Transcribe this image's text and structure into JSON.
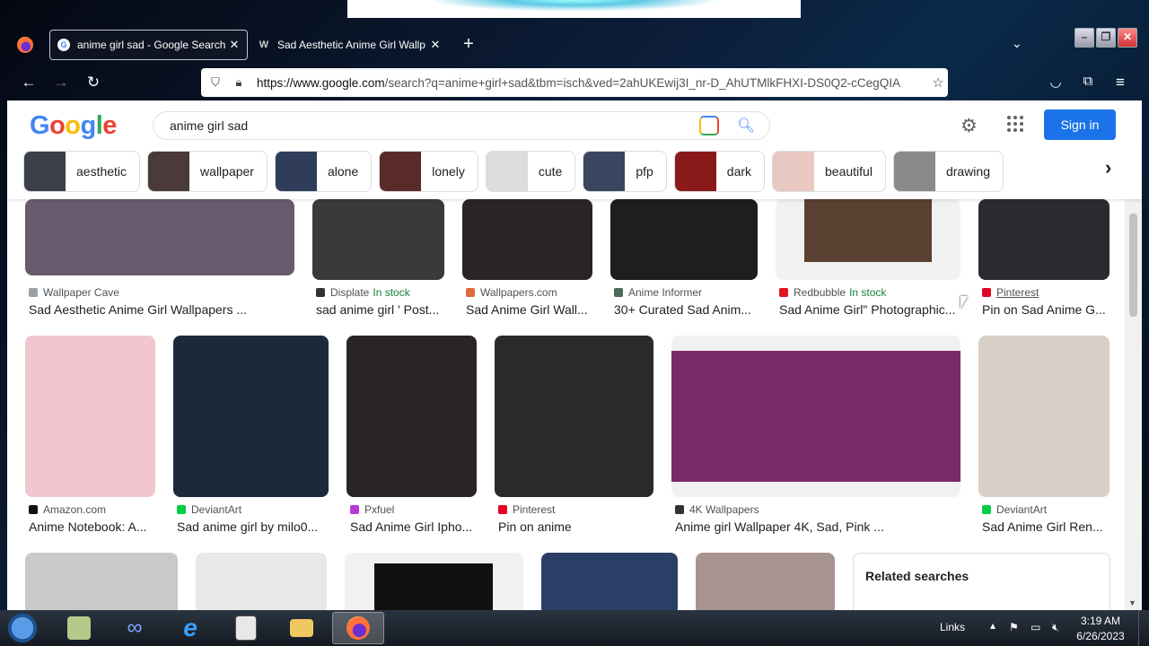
{
  "browser": {
    "tabs": [
      {
        "title": "anime girl sad - Google Search",
        "active": true,
        "favicon": "G"
      },
      {
        "title": "Sad Aesthetic Anime Girl Wallp",
        "active": false,
        "favicon": "W"
      }
    ],
    "url_domain": "https://www.google.com",
    "url_rest": "/search?q=anime+girl+sad&tbm=isch&ved=2ahUKEwij3I_nr-D_AhUTMlkFHXI-DS0Q2-cCegQIA"
  },
  "google": {
    "query": "anime girl sad",
    "sign_in": "Sign in",
    "chips": [
      {
        "label": "aesthetic",
        "color": "#3a3f4a"
      },
      {
        "label": "wallpaper",
        "color": "#4a3a3a"
      },
      {
        "label": "alone",
        "color": "#2f3d5a"
      },
      {
        "label": "lonely",
        "color": "#5a2a2a"
      },
      {
        "label": "cute",
        "color": "#dcdcdc"
      },
      {
        "label": "pfp",
        "color": "#3a4560"
      },
      {
        "label": "dark",
        "color": "#8a1a1a"
      },
      {
        "label": "beautiful",
        "color": "#e8c8c0"
      },
      {
        "label": "drawing",
        "color": "#8a8a8a"
      }
    ]
  },
  "results_row1": [
    {
      "source": "Wallpaper Cave",
      "title": "Sad Aesthetic Anime Girl Wallpapers ...",
      "stock": "",
      "fav": "#9aa0a6",
      "img": "#6a5a70"
    },
    {
      "source": "Displate",
      "title": "sad anime girl ' Post...",
      "stock": "In stock",
      "fav": "#333",
      "img": "#3a3a3a"
    },
    {
      "source": "Wallpapers.com",
      "title": "Sad Anime Girl Wall...",
      "stock": "",
      "fav": "#e06a3a",
      "img": "#2a2426"
    },
    {
      "source": "Anime Informer",
      "title": "30+ Curated Sad Anim...",
      "stock": "",
      "fav": "#4a6a5a",
      "img": "#1e1e1e"
    },
    {
      "source": "Redbubble",
      "title": "Sad Anime Girl\" Photographic...",
      "stock": "In stock",
      "fav": "#e41321",
      "img": "#5a4030"
    },
    {
      "source": "Pinterest",
      "title": "Pin on Sad Anime G...",
      "stock": "",
      "fav": "#e60023",
      "img": "#2a2a30"
    }
  ],
  "results_row2": [
    {
      "source": "Amazon.com",
      "title": "Anime Notebook: A...",
      "fav": "#111",
      "img": "#f2c6cf"
    },
    {
      "source": "DeviantArt",
      "title": "Sad anime girl by milo0...",
      "fav": "#05cc47",
      "img": "#1a2a3a"
    },
    {
      "source": "Pxfuel",
      "title": "Sad Anime Girl Ipho...",
      "fav": "#b53ad6",
      "img": "#2a2426"
    },
    {
      "source": "Pinterest",
      "title": "Pin on anime",
      "fav": "#e60023",
      "img": "#2a2a2a"
    },
    {
      "source": "4K Wallpapers",
      "title": "Anime girl Wallpaper 4K, Sad, Pink ...",
      "fav": "#333",
      "img": "#7a2a6a"
    },
    {
      "source": "DeviantArt",
      "title": "Sad Anime Girl Ren...",
      "fav": "#05cc47",
      "img": "#d8d0c8"
    }
  ],
  "related": {
    "heading": "Related searches"
  },
  "taskbar": {
    "links": "Links",
    "time": "3:19 AM",
    "date": "6/26/2023"
  }
}
